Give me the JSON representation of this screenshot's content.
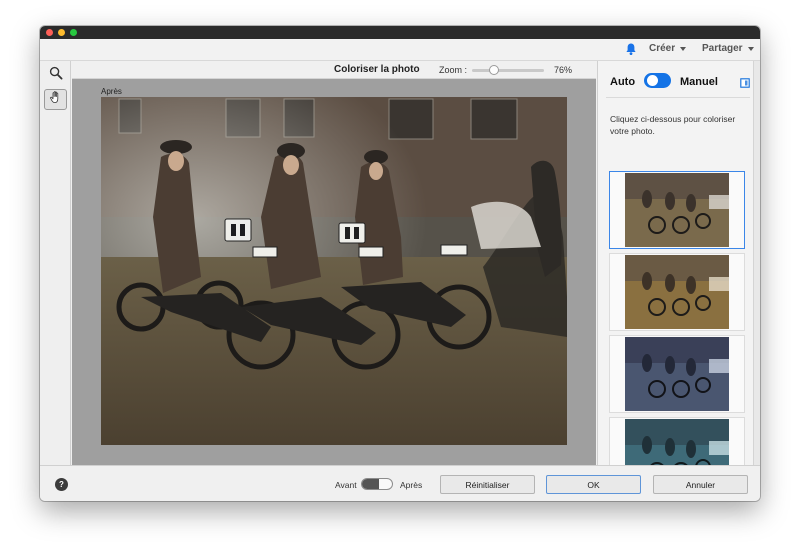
{
  "menu": {
    "creer": "Créer",
    "partager": "Partager"
  },
  "editor": {
    "title": "Coloriser la photo",
    "zoom_label": "Zoom :",
    "zoom_value": "76%",
    "zoom_level": 0.3,
    "view_label": "Après"
  },
  "panel": {
    "auto_label": "Auto",
    "manual_label": "Manuel",
    "mode_toggle_on": true,
    "instruction": "Cliquez ci-dessous pour coloriser votre photo.",
    "variants": [
      {
        "name": "variant-1",
        "tint": "#7a6a4c",
        "selected": true
      },
      {
        "name": "variant-2",
        "tint": "#8a7040",
        "selected": false
      },
      {
        "name": "variant-3",
        "tint": "#4a5670",
        "selected": false
      },
      {
        "name": "variant-4",
        "tint": "#3e6a78",
        "selected": false
      }
    ]
  },
  "footer": {
    "avant": "Avant",
    "apres": "Après",
    "reset": "Réinitialiser",
    "ok": "OK",
    "cancel": "Annuler"
  },
  "colors": {
    "accent": "#1473e6",
    "bell": "#1a73e8"
  }
}
